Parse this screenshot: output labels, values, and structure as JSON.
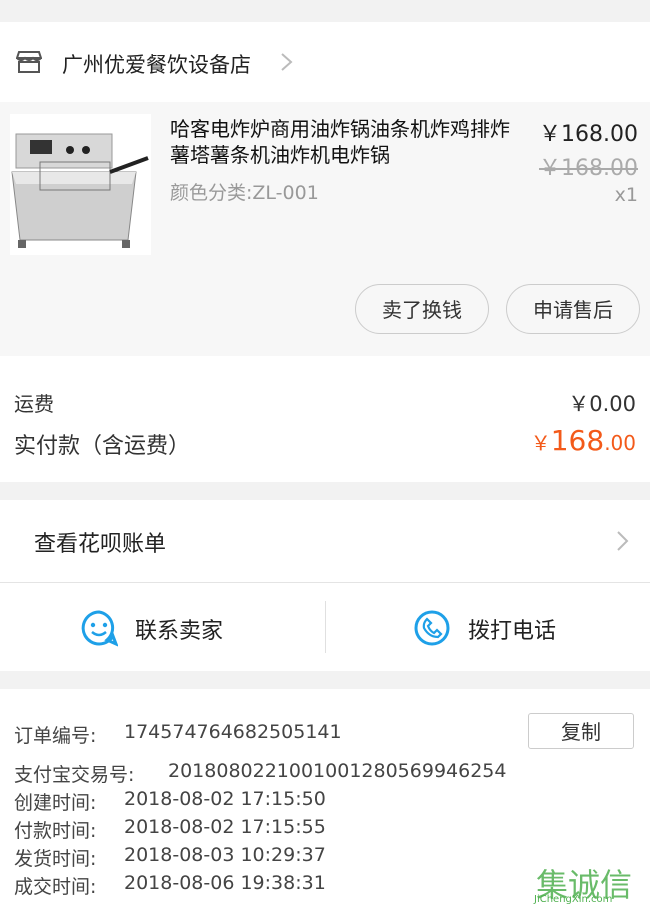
{
  "store": {
    "name": "广州优爱餐饮设备店",
    "icon": "store-icon"
  },
  "product": {
    "title": "哈客电炸炉商用油炸锅油条机炸鸡排炸薯塔薯条机油炸机电炸锅",
    "variant": "颜色分类:ZL-001",
    "price": "￥168.00",
    "original_price": "￥168.00",
    "quantity": "x1",
    "buttons": {
      "sell": "卖了换钱",
      "after_sale": "申请售后"
    }
  },
  "fees": {
    "shipping_label": "运费",
    "shipping_value": "￥0.00",
    "paid_label": "实付款（含运费）",
    "paid_currency": "￥",
    "paid_int": "168",
    "paid_dec": ".00"
  },
  "huabei": {
    "label": "查看花呗账单"
  },
  "contact": {
    "seller": "联系卖家",
    "phone": "拨打电话"
  },
  "order": {
    "order_no_label": "订单编号:",
    "order_no": "1745747646825051​41",
    "copy_label": "复制",
    "alipay_label": "支付宝交易号:",
    "alipay_no": "2018080221001001280569946254",
    "created_label": "创建时间:",
    "created": "2018-08-02 17:15:50",
    "paid_label": "付款时间:",
    "paid": "2018-08-02 17:15:55",
    "shipped_label": "发货时间:",
    "shipped": "2018-08-03 10:29:37",
    "done_label": "成交时间:",
    "done": "2018-08-06 19:38:31"
  },
  "watermark": {
    "logo": "集诚信",
    "url": "JiChengXin.com"
  },
  "colors": {
    "accent_price": "#f35a1a",
    "contact_icon": "#1ea0e8"
  }
}
